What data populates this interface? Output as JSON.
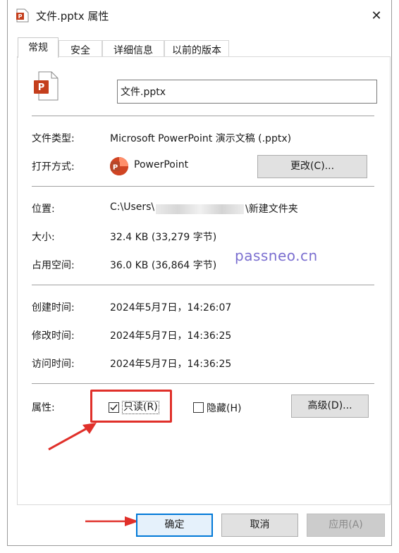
{
  "window": {
    "title": "文件.pptx 属性",
    "close_glyph": "✕"
  },
  "tabs": [
    {
      "label": "常规",
      "active": true
    },
    {
      "label": "安全",
      "active": false
    },
    {
      "label": "详细信息",
      "active": false
    },
    {
      "label": "以前的版本",
      "active": false
    }
  ],
  "general": {
    "file_name": "文件.pptx",
    "type_label": "文件类型:",
    "type_value": "Microsoft PowerPoint 演示文稿 (.pptx)",
    "opens_with_label": "打开方式:",
    "opens_with_value": "PowerPoint",
    "change_button": "更改(C)...",
    "location_label": "位置:",
    "location_value_start": "C:\\Users\\",
    "location_value_end": "\\新建文件夹",
    "size_label": "大小:",
    "size_value": "32.4 KB (33,279 字节)",
    "size_on_disk_label": "占用空间:",
    "size_on_disk_value": "36.0 KB (36,864 字节)",
    "created_label": "创建时间:",
    "created_value": "2024年5月7日，14:26:07",
    "modified_label": "修改时间:",
    "modified_value": "2024年5月7日，14:36:25",
    "accessed_label": "访问时间:",
    "accessed_value": "2024年5月7日，14:36:25",
    "attributes_label": "属性:",
    "readonly_label": "只读(R)",
    "readonly_checked": true,
    "hidden_label": "隐藏(H)",
    "hidden_checked": false,
    "advanced_button": "高级(D)..."
  },
  "watermark": "passneo.cn",
  "footer": {
    "ok_button": "确定",
    "cancel_button": "取消",
    "apply_button": "应用(A)"
  },
  "annotation": {
    "highlight_color": "#e0302a"
  }
}
